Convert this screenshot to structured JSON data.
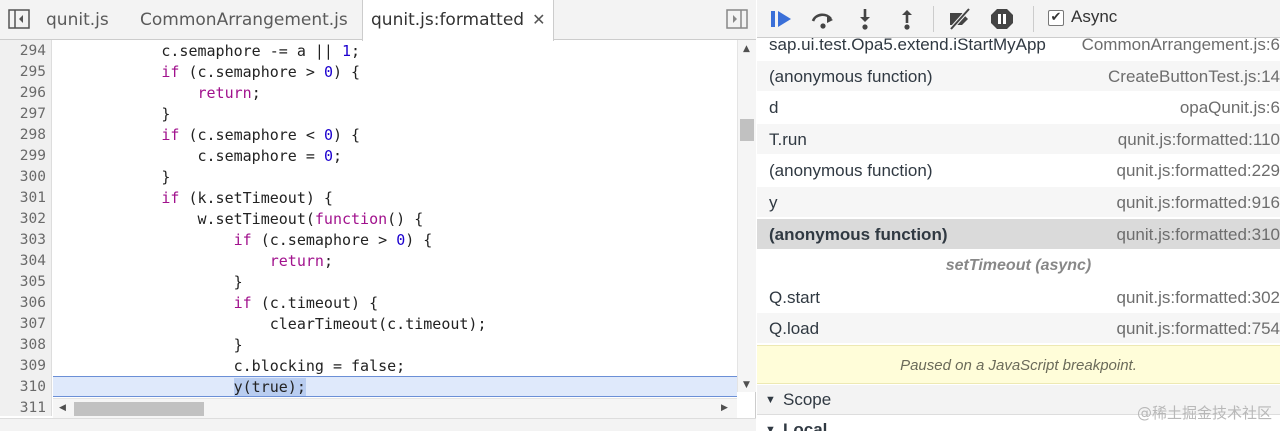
{
  "editor": {
    "tabs": [
      {
        "label": "qunit.js",
        "active": false
      },
      {
        "label": "CommonArrangement.js",
        "active": false
      },
      {
        "label": "qunit.js:formatted",
        "active": true
      }
    ],
    "close_glyph": "✕",
    "lines": [
      {
        "no": "294",
        "tokens": [
          {
            "t": "            c.semaphore -= a || "
          },
          {
            "t": "1",
            "c": "num"
          },
          {
            "t": ";"
          }
        ]
      },
      {
        "no": "295",
        "tokens": [
          {
            "t": "            "
          },
          {
            "t": "if",
            "c": "kw"
          },
          {
            "t": " (c.semaphore > "
          },
          {
            "t": "0",
            "c": "num"
          },
          {
            "t": ") {"
          }
        ]
      },
      {
        "no": "296",
        "tokens": [
          {
            "t": "                "
          },
          {
            "t": "return",
            "c": "kw"
          },
          {
            "t": ";"
          }
        ]
      },
      {
        "no": "297",
        "tokens": [
          {
            "t": "            }"
          }
        ]
      },
      {
        "no": "298",
        "tokens": [
          {
            "t": "            "
          },
          {
            "t": "if",
            "c": "kw"
          },
          {
            "t": " (c.semaphore < "
          },
          {
            "t": "0",
            "c": "num"
          },
          {
            "t": ") {"
          }
        ]
      },
      {
        "no": "299",
        "tokens": [
          {
            "t": "                c.semaphore = "
          },
          {
            "t": "0",
            "c": "num"
          },
          {
            "t": ";"
          }
        ]
      },
      {
        "no": "300",
        "tokens": [
          {
            "t": "            }"
          }
        ]
      },
      {
        "no": "301",
        "tokens": [
          {
            "t": "            "
          },
          {
            "t": "if",
            "c": "kw"
          },
          {
            "t": " (k.setTimeout) {"
          }
        ]
      },
      {
        "no": "302",
        "tokens": [
          {
            "t": "                w.setTimeout("
          },
          {
            "t": "function",
            "c": "kw"
          },
          {
            "t": "() {"
          }
        ]
      },
      {
        "no": "303",
        "tokens": [
          {
            "t": "                    "
          },
          {
            "t": "if",
            "c": "kw"
          },
          {
            "t": " (c.semaphore > "
          },
          {
            "t": "0",
            "c": "num"
          },
          {
            "t": ") {"
          }
        ]
      },
      {
        "no": "304",
        "tokens": [
          {
            "t": "                        "
          },
          {
            "t": "return",
            "c": "kw"
          },
          {
            "t": ";"
          }
        ]
      },
      {
        "no": "305",
        "tokens": [
          {
            "t": "                    }"
          }
        ]
      },
      {
        "no": "306",
        "tokens": [
          {
            "t": "                    "
          },
          {
            "t": "if",
            "c": "kw"
          },
          {
            "t": " (c.timeout) {"
          }
        ]
      },
      {
        "no": "307",
        "tokens": [
          {
            "t": "                        clearTimeout(c.timeout);"
          }
        ]
      },
      {
        "no": "308",
        "tokens": [
          {
            "t": "                    }"
          }
        ]
      },
      {
        "no": "309",
        "tokens": [
          {
            "t": "                    c.blocking = false;"
          }
        ]
      },
      {
        "no": "310",
        "highlight": true,
        "tokens": [
          {
            "t": "                    "
          },
          {
            "t": "y(true);",
            "c": "sel"
          }
        ]
      },
      {
        "no": "311",
        "tokens": []
      }
    ]
  },
  "debugger": {
    "async_label": "Async",
    "async_checked": true,
    "check_glyph": "✔",
    "frames": [
      {
        "fn": "sap.ui.test.Opa5.extend.iStartMyApp",
        "loc": "CommonArrangement.js:6"
      },
      {
        "fn": "(anonymous function)",
        "loc": "CreateButtonTest.js:14"
      },
      {
        "fn": "d",
        "loc": "opaQunit.js:6"
      },
      {
        "fn": "T.run",
        "loc": "qunit.js:formatted:110"
      },
      {
        "fn": "(anonymous function)",
        "loc": "qunit.js:formatted:229"
      },
      {
        "fn": "y",
        "loc": "qunit.js:formatted:916"
      },
      {
        "fn": "(anonymous function)",
        "loc": "qunit.js:formatted:310",
        "selected": true
      },
      {
        "async": true,
        "label": "setTimeout (async)"
      },
      {
        "fn": "Q.start",
        "loc": "qunit.js:formatted:302"
      },
      {
        "fn": "Q.load",
        "loc": "qunit.js:formatted:754"
      }
    ],
    "paused_message": "Paused on a JavaScript breakpoint.",
    "sections": [
      {
        "title": "Scope",
        "expanded": true
      },
      {
        "title": "Local",
        "expanded": true
      }
    ],
    "triangle_glyph": "▼"
  },
  "watermark": "@稀土掘金技术社区",
  "colors": {
    "keyword": "#a1128d",
    "number": "#1c00cf",
    "accent_blue": "#3a6fd8",
    "highlight_line": "#dfe9fb",
    "paused_bg": "#fffdd9"
  }
}
